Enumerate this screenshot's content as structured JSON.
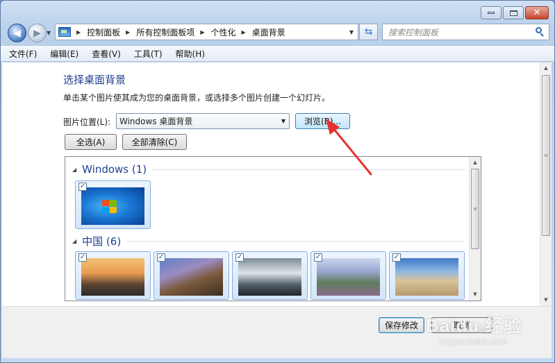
{
  "window": {
    "caption_minimize": "minimize",
    "caption_maximize": "maximize",
    "caption_close": "close"
  },
  "address_bar": {
    "crumbs": [
      "控制面板",
      "所有控制面板项",
      "个性化",
      "桌面背景"
    ]
  },
  "search": {
    "placeholder": "搜索控制面板"
  },
  "menu": [
    "文件(F)",
    "编辑(E)",
    "查看(V)",
    "工具(T)",
    "帮助(H)"
  ],
  "page": {
    "title": "选择桌面背景",
    "description": "单击某个图片使其成为您的桌面背景，或选择多个图片创建一个幻灯片。",
    "location_label": "图片位置(L):",
    "location_value": "Windows 桌面背景",
    "browse_label": "浏览(B)...",
    "select_all_label": "全选(A)",
    "clear_all_label": "全部清除(C)"
  },
  "gallery": {
    "groups": [
      {
        "name": "Windows (1)",
        "thumbnails": [
          {
            "checked": true,
            "check": "✓"
          }
        ]
      },
      {
        "name": "中国 (6)",
        "thumbnails": [
          {
            "checked": true,
            "check": "✓"
          },
          {
            "checked": true,
            "check": "✓"
          },
          {
            "checked": true,
            "check": "✓"
          },
          {
            "checked": true,
            "check": "✓"
          },
          {
            "checked": true,
            "check": "✓"
          }
        ]
      }
    ]
  },
  "footer": {
    "save_label": "保存修改",
    "cancel_label": "取消"
  },
  "watermark": {
    "text": "Baidu 经验",
    "sub": "jingyan.baidu.com"
  },
  "colors": {
    "accent": "#1e3f8f",
    "annotation_arrow": "#e8312f"
  }
}
